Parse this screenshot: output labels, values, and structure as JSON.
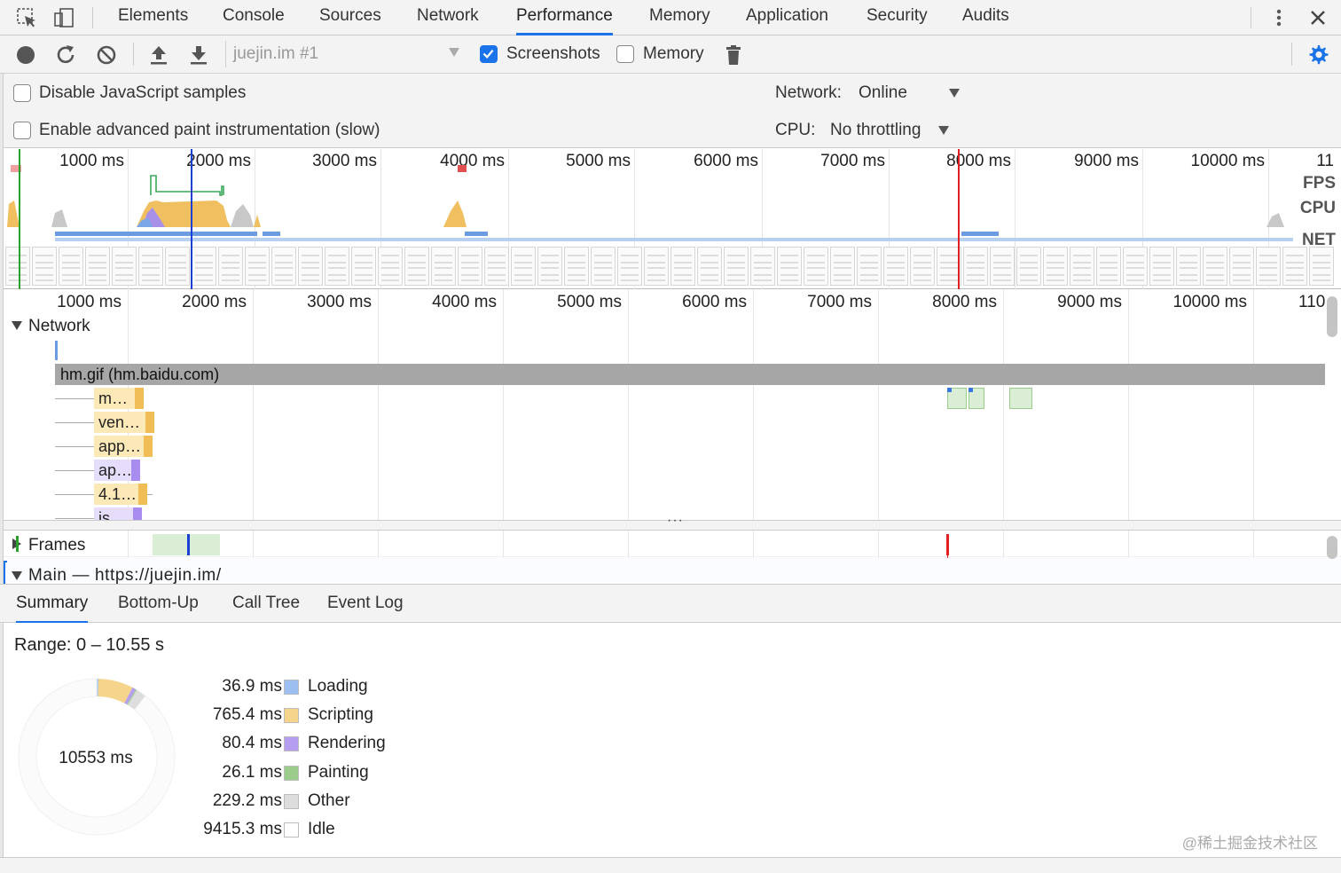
{
  "tabs": [
    "Elements",
    "Console",
    "Sources",
    "Network",
    "Performance",
    "Memory",
    "Application",
    "Security",
    "Audits"
  ],
  "active_tab": "Performance",
  "toolbar": {
    "profile": "juejin.im #1",
    "screenshots_label": "Screenshots",
    "screenshots_checked": true,
    "memory_label": "Memory",
    "memory_checked": false
  },
  "settings": {
    "disable_js_label": "Disable JavaScript samples",
    "advanced_paint_label": "Enable advanced paint instrumentation (slow)",
    "network_label": "Network:",
    "network_value": "Online",
    "cpu_label": "CPU:",
    "cpu_value": "No throttling"
  },
  "overview": {
    "ticks": [
      "1000 ms",
      "2000 ms",
      "3000 ms",
      "4000 ms",
      "5000 ms",
      "6000 ms",
      "7000 ms",
      "8000 ms",
      "9000 ms",
      "10000 ms",
      "11"
    ],
    "tags": [
      "FPS",
      "CPU",
      "NET"
    ]
  },
  "timeline": {
    "ticks": [
      "1000 ms",
      "2000 ms",
      "3000 ms",
      "4000 ms",
      "5000 ms",
      "6000 ms",
      "7000 ms",
      "8000 ms",
      "9000 ms",
      "10000 ms",
      "110"
    ],
    "network_label": "Network",
    "main_request": "hm.gif (hm.baidu.com)",
    "requests": [
      "m…",
      "ven…",
      "app…",
      "ap…",
      "4.1…",
      "js…"
    ]
  },
  "tracks": {
    "frames_label": "Frames",
    "main_label": "Main — https://juejin.im/"
  },
  "bottom_tabs": [
    "Summary",
    "Bottom-Up",
    "Call Tree",
    "Event Log"
  ],
  "active_bottom_tab": "Summary",
  "summary": {
    "range": "Range: 0 – 10.55 s",
    "total": "10553 ms",
    "items": [
      {
        "value": "36.9 ms",
        "name": "Loading",
        "color": "#9cbef0"
      },
      {
        "value": "765.4 ms",
        "name": "Scripting",
        "color": "#f5d58c"
      },
      {
        "value": "80.4 ms",
        "name": "Rendering",
        "color": "#b59ef0"
      },
      {
        "value": "26.1 ms",
        "name": "Painting",
        "color": "#9ccc8c"
      },
      {
        "value": "229.2 ms",
        "name": "Other",
        "color": "#dddddd"
      },
      {
        "value": "9415.3 ms",
        "name": "Idle",
        "color": "#ffffff"
      }
    ]
  },
  "watermark": "@稀土掘金技术社区"
}
